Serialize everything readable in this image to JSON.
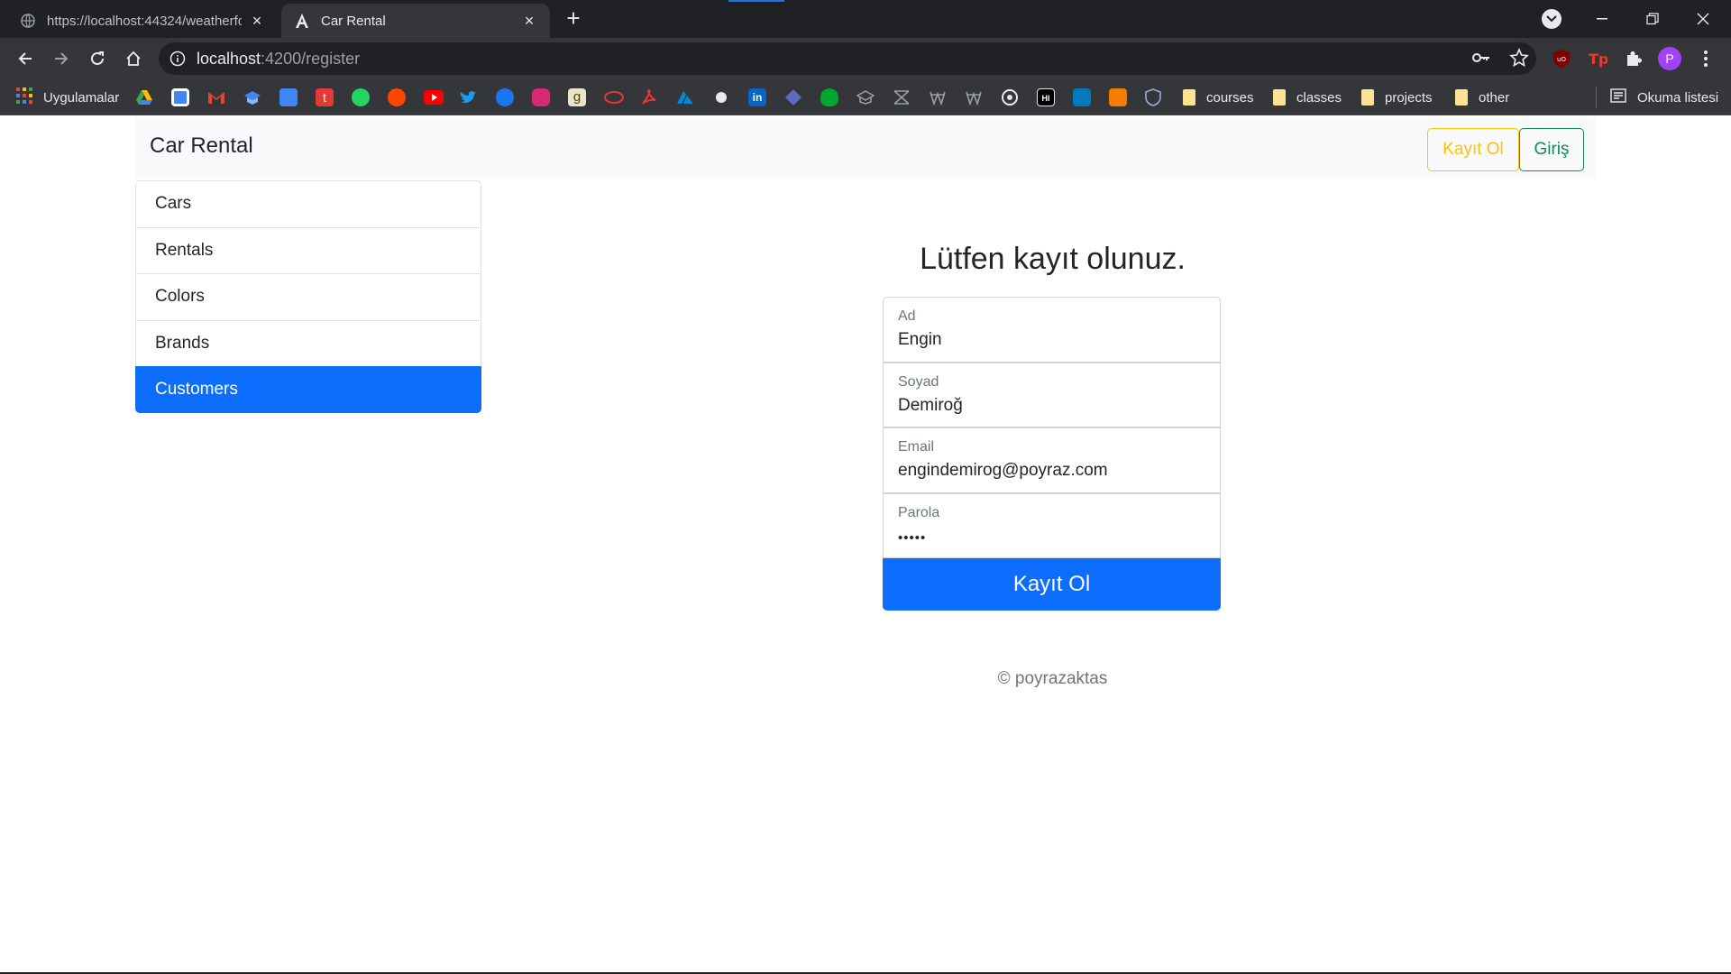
{
  "browser": {
    "tabs": [
      {
        "title": "https://localhost:44324/weatherforecast",
        "active": false
      },
      {
        "title": "Car Rental",
        "active": true
      }
    ],
    "url_host": "localhost",
    "url_path": ":4200/register",
    "bookmarks": {
      "apps_label": "Uygulamalar",
      "folders": [
        "courses",
        "classes",
        "projects",
        "other"
      ],
      "reading_list": "Okuma listesi"
    },
    "profile_initial": "P"
  },
  "app": {
    "brand": "Car Rental",
    "register_button": "Kayıt Ol",
    "login_button": "Giriş",
    "sidebar": [
      {
        "label": "Cars",
        "active": false
      },
      {
        "label": "Rentals",
        "active": false
      },
      {
        "label": "Colors",
        "active": false
      },
      {
        "label": "Brands",
        "active": false
      },
      {
        "label": "Customers",
        "active": true
      }
    ],
    "heading": "Lütfen kayıt olunuz.",
    "fields": [
      {
        "label": "Ad",
        "value": "Engin"
      },
      {
        "label": "Soyad",
        "value": "Demiroğ"
      },
      {
        "label": "Email",
        "value": "engindemirog@poyraz.com"
      },
      {
        "label": "Parola",
        "value": "•••••"
      }
    ],
    "submit_label": "Kayıt Ol",
    "footer": "© poyrazaktas"
  },
  "colors": {
    "primary": "#0d6efd",
    "warning": "#ffc107",
    "success": "#198754",
    "chrome_dark": "#202124",
    "chrome_toolbar": "#35363a"
  }
}
